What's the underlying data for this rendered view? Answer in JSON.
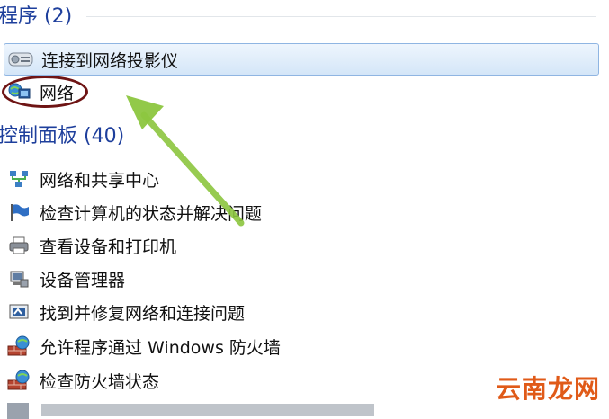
{
  "groups": {
    "programs": {
      "title": "程序 (2)",
      "items": [
        {
          "label": "连接到网络投影仪",
          "icon": "projector-icon"
        },
        {
          "label": "网络",
          "icon": "network-icon"
        }
      ]
    },
    "control_panel": {
      "title": "控制面板 (40)",
      "items": [
        {
          "label": "网络和共享中心",
          "icon": "network-sharing-icon"
        },
        {
          "label": "检查计算机的状态并解决问题",
          "icon": "action-center-flag-icon"
        },
        {
          "label": "查看设备和打印机",
          "icon": "printer-icon"
        },
        {
          "label": "设备管理器",
          "icon": "device-manager-icon"
        },
        {
          "label": "找到并修复网络和连接问题",
          "icon": "troubleshoot-icon"
        },
        {
          "label": "允许程序通过 Windows 防火墙",
          "icon": "firewall-icon"
        },
        {
          "label": "检查防火墙状态",
          "icon": "firewall-icon"
        }
      ]
    }
  },
  "watermark": "云南龙网",
  "colors": {
    "header": "#1e3f9c",
    "selection": "#d4e6f8",
    "oval": "#6e1414",
    "arrow": "#8cc63f"
  }
}
